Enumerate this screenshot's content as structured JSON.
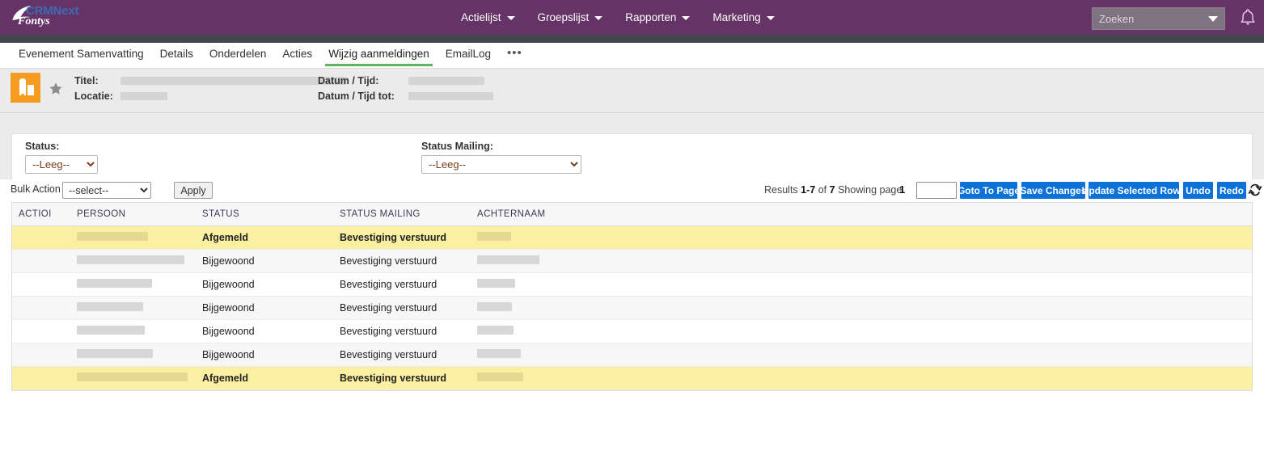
{
  "brand": {
    "product": "CRMNext",
    "org": "Fontys",
    "purple": "#663366",
    "accent_blue": "#0d72d8",
    "active_tab_green": "#5cb85c",
    "highlight_yellow": "#fbf0a2",
    "icon_orange": "#f59b1f"
  },
  "topnav": {
    "items": [
      {
        "label": "Actielijst",
        "has_dropdown": true
      },
      {
        "label": "Groepslijst",
        "has_dropdown": true
      },
      {
        "label": "Rapporten",
        "has_dropdown": true
      },
      {
        "label": "Marketing",
        "has_dropdown": true
      }
    ],
    "search": {
      "placeholder": "Zoeken",
      "value": "",
      "icon": "chevron-down-icon"
    },
    "notifications_icon": "bell-icon"
  },
  "tabs": {
    "items": [
      {
        "label": "Evenement Samenvatting",
        "active": false
      },
      {
        "label": "Details",
        "active": false
      },
      {
        "label": "Onderdelen",
        "active": false
      },
      {
        "label": "Acties",
        "active": false
      },
      {
        "label": "Wijzig aanmeldingen",
        "active": true
      },
      {
        "label": "EmailLog",
        "active": false
      }
    ],
    "overflow_label": "•••"
  },
  "record_header": {
    "icon": "building-icon",
    "favorite_icon": "star-icon",
    "fields": [
      {
        "label": "Titel:",
        "value": "",
        "redacted": true
      },
      {
        "label": "Locatie:",
        "value": "",
        "redacted": true
      },
      {
        "label": "Datum / Tijd:",
        "value": "",
        "redacted": true
      },
      {
        "label": "Datum / Tijd tot:",
        "value": "",
        "redacted": true
      }
    ]
  },
  "filters": {
    "status": {
      "label": "Status:",
      "value": "--Leeg--",
      "options": [
        "--Leeg--"
      ]
    },
    "status_mailing": {
      "label": "Status Mailing:",
      "value": "--Leeg--",
      "options": [
        "--Leeg--"
      ]
    }
  },
  "toolbar": {
    "bulk_action_label": "Bulk Action",
    "bulk_action_value": "--select--",
    "bulk_action_options": [
      "--select--"
    ],
    "apply_label": "Apply",
    "results_prefix": "Results",
    "results_range": "1-7",
    "results_of": "of",
    "results_total": "7",
    "showing_page_label": "Showing page",
    "current_page": "1",
    "page_input_value": "",
    "goto_page_label": "Goto To Page",
    "save_changes_label": "Save Changes",
    "update_selected_label": "Update Selected Rows",
    "undo_label": "Undo",
    "redo_label": "Redo",
    "refresh_icon": "refresh-icon"
  },
  "table": {
    "columns": [
      {
        "key": "action",
        "label": "ACTIOI"
      },
      {
        "key": "person",
        "label": "PERSOON"
      },
      {
        "key": "status",
        "label": "STATUS"
      },
      {
        "key": "mailing",
        "label": "STATUS MAILING"
      },
      {
        "key": "lastname",
        "label": "ACHTERNAAM"
      }
    ],
    "rows": [
      {
        "action": "",
        "person": "",
        "person_redacted": true,
        "person_w": 88,
        "status": "Afgemeld",
        "mailing": "Bevestiging verstuurd",
        "lastname": "",
        "lastname_redacted": true,
        "lastname_w": 42,
        "style": "yellow"
      },
      {
        "action": "",
        "person": "",
        "person_redacted": true,
        "person_w": 133,
        "status": "Bijgewoond",
        "mailing": "Bevestiging verstuurd",
        "lastname": "",
        "lastname_redacted": true,
        "lastname_w": 77,
        "style": "gray"
      },
      {
        "action": "",
        "person": "",
        "person_redacted": true,
        "person_w": 93,
        "status": "Bijgewoond",
        "mailing": "Bevestiging verstuurd",
        "lastname": "",
        "lastname_redacted": true,
        "lastname_w": 47,
        "style": "white"
      },
      {
        "action": "",
        "person": "",
        "person_redacted": true,
        "person_w": 82,
        "status": "Bijgewoond",
        "mailing": "Bevestiging verstuurd",
        "lastname": "",
        "lastname_redacted": true,
        "lastname_w": 43,
        "style": "gray"
      },
      {
        "action": "",
        "person": "",
        "person_redacted": true,
        "person_w": 84,
        "status": "Bijgewoond",
        "mailing": "Bevestiging verstuurd",
        "lastname": "",
        "lastname_redacted": true,
        "lastname_w": 45,
        "style": "white"
      },
      {
        "action": "",
        "person": "",
        "person_redacted": true,
        "person_w": 94,
        "status": "Bijgewoond",
        "mailing": "Bevestiging verstuurd",
        "lastname": "",
        "lastname_redacted": true,
        "lastname_w": 54,
        "style": "gray"
      },
      {
        "action": "",
        "person": "",
        "person_redacted": true,
        "person_w": 137,
        "status": "Afgemeld",
        "mailing": "Bevestiging verstuurd",
        "lastname": "",
        "lastname_redacted": true,
        "lastname_w": 57,
        "style": "yellow"
      }
    ]
  }
}
